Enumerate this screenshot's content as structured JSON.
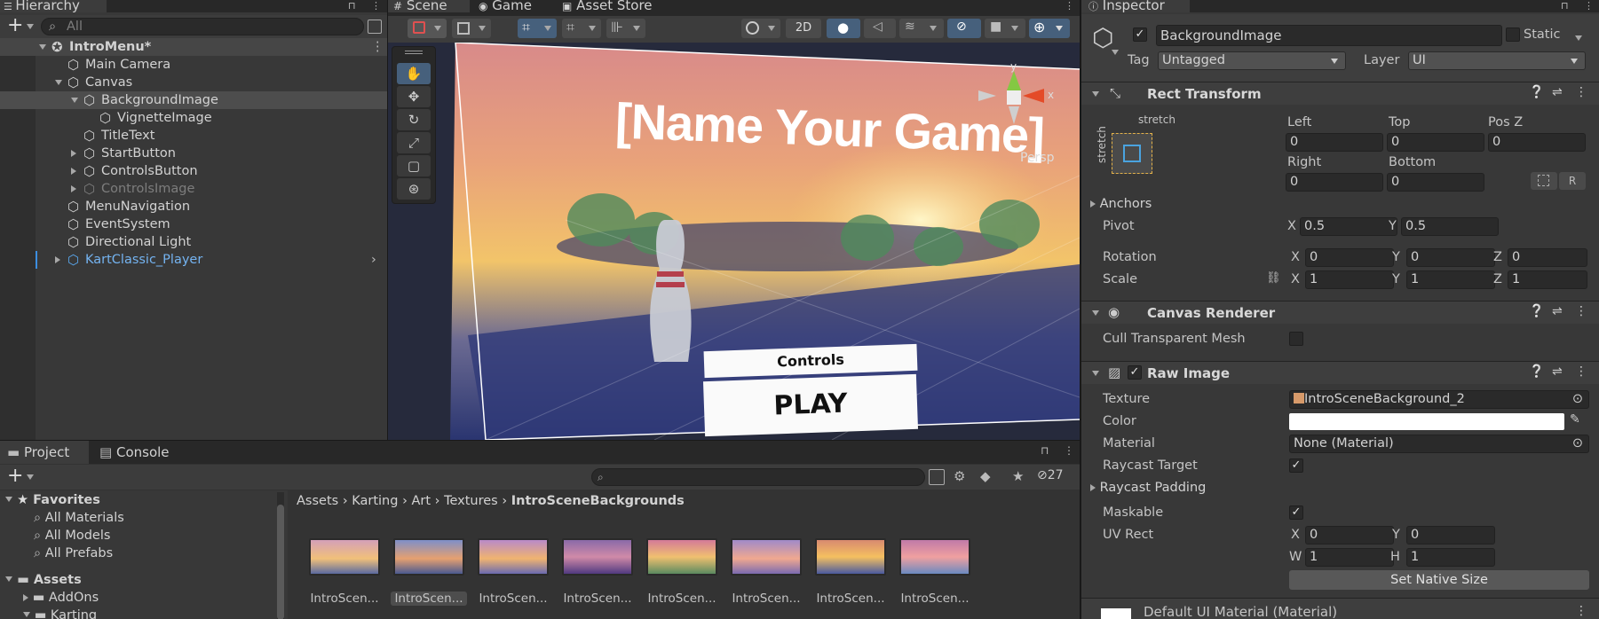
{
  "tabs": {
    "hierarchy": "Hierarchy",
    "scene": "Scene",
    "game": "Game",
    "asset_store": "Asset Store",
    "inspector": "Inspector",
    "project": "Project",
    "console": "Console"
  },
  "hierarchy": {
    "search_placeholder": "All",
    "items": [
      {
        "label": "IntroMenu*",
        "depth": 0,
        "scene": true,
        "expanded": true,
        "selected": false,
        "disabled": false,
        "prefab": false,
        "foldout": "open"
      },
      {
        "label": "Main Camera",
        "depth": 1,
        "foldout": "none"
      },
      {
        "label": "Canvas",
        "depth": 1,
        "foldout": "open"
      },
      {
        "label": "BackgroundImage",
        "depth": 2,
        "foldout": "open",
        "selected": true
      },
      {
        "label": "VignetteImage",
        "depth": 3,
        "foldout": "none"
      },
      {
        "label": "TitleText",
        "depth": 2,
        "foldout": "none"
      },
      {
        "label": "StartButton",
        "depth": 2,
        "foldout": "closed"
      },
      {
        "label": "ControlsButton",
        "depth": 2,
        "foldout": "closed"
      },
      {
        "label": "ControlsImage",
        "depth": 2,
        "foldout": "closed",
        "disabled": true
      },
      {
        "label": "MenuNavigation",
        "depth": 1,
        "foldout": "none"
      },
      {
        "label": "EventSystem",
        "depth": 1,
        "foldout": "none"
      },
      {
        "label": "Directional Light",
        "depth": 1,
        "foldout": "none"
      },
      {
        "label": "KartClassic_Player",
        "depth": 1,
        "foldout": "closed",
        "prefab": true
      }
    ]
  },
  "scene": {
    "toolbar_2d": "2D",
    "title_text": "[Name Your Game]",
    "controls_label": "Controls",
    "play_label": "PLAY",
    "persp_label": "Persp",
    "gizmo_y": "y",
    "gizmo_x": "x"
  },
  "inspector": {
    "object_name": "BackgroundImage",
    "static_label": "Static",
    "tag_label": "Tag",
    "tag_value": "Untagged",
    "layer_label": "Layer",
    "layer_value": "UI",
    "rect_transform": {
      "title": "Rect Transform",
      "stretch_h": "stretch",
      "stretch_v": "stretch",
      "left_label": "Left",
      "left": "0",
      "top_label": "Top",
      "top": "0",
      "posz_label": "Pos Z",
      "posz": "0",
      "right_label": "Right",
      "right": "0",
      "bottom_label": "Bottom",
      "bottom": "0",
      "anchors_label": "Anchors",
      "pivot_label": "Pivot",
      "pivot_x": "0.5",
      "pivot_y": "0.5",
      "rotation_label": "Rotation",
      "rot_x": "0",
      "rot_y": "0",
      "rot_z": "0",
      "scale_label": "Scale",
      "scale_x": "1",
      "scale_y": "1",
      "scale_z": "1",
      "x": "X",
      "y": "Y",
      "z": "Z",
      "r_btn": "R"
    },
    "canvas_renderer": {
      "title": "Canvas Renderer",
      "cull_label": "Cull Transparent Mesh"
    },
    "raw_image": {
      "title": "Raw Image",
      "texture_label": "Texture",
      "texture_value": "IntroSceneBackground_2",
      "color_label": "Color",
      "material_label": "Material",
      "material_value": "None (Material)",
      "raycast_target_label": "Raycast Target",
      "raycast_padding_label": "Raycast Padding",
      "maskable_label": "Maskable",
      "uvrect_label": "UV Rect",
      "uv_x": "0",
      "uv_y": "0",
      "uv_w": "1",
      "uv_h": "1",
      "w": "W",
      "h": "H",
      "native_size_button": "Set Native Size"
    },
    "default_material": "Default UI Material (Material)"
  },
  "project": {
    "favorites_label": "Favorites",
    "favorites": [
      "All Materials",
      "All Models",
      "All Prefabs"
    ],
    "assets_label": "Assets",
    "assets_children": [
      "AddOns",
      "Karting"
    ],
    "breadcrumb": [
      "Assets",
      "Karting",
      "Art",
      "Textures",
      "IntroSceneBackgrounds"
    ],
    "hidden_count": "27",
    "thumbnails": [
      "IntroScen...",
      "IntroScen...",
      "IntroScen...",
      "IntroScen...",
      "IntroScen...",
      "IntroScen...",
      "IntroScen...",
      "IntroScen..."
    ]
  }
}
